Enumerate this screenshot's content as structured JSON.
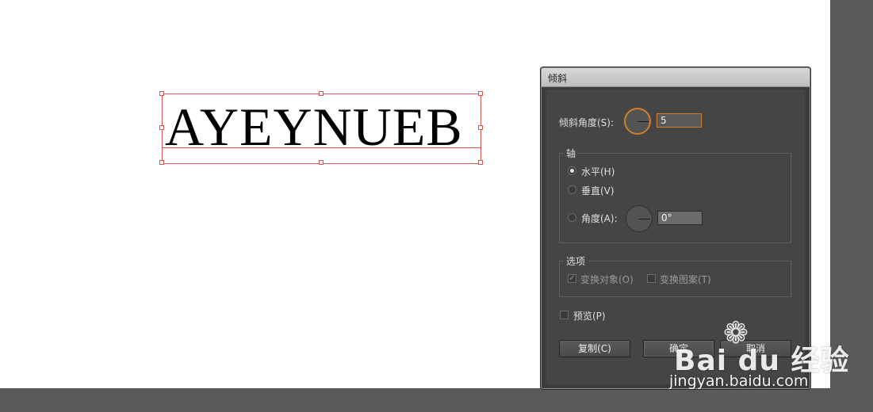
{
  "artboard": {
    "text": "AYEYNUEB"
  },
  "dialog": {
    "title": "倾斜",
    "shear_angle": {
      "label": "倾斜角度(S):",
      "value": "5"
    },
    "axis": {
      "group_title": "轴",
      "options": [
        {
          "label": "水平(H)",
          "selected": true
        },
        {
          "label": "垂直(V)",
          "selected": false
        },
        {
          "label": "角度(A):",
          "selected": false
        }
      ],
      "angle_value": "0°"
    },
    "options": {
      "group_title": "选项",
      "transform_objects": {
        "label": "变换对象(O)",
        "checked": true
      },
      "transform_patterns": {
        "label": "变换图案(T)",
        "checked": false
      }
    },
    "preview": {
      "label": "预览(P)",
      "checked": false
    },
    "buttons": {
      "copy": "复制(C)",
      "ok": "确定",
      "cancel": "取消"
    }
  },
  "watermark": {
    "brand": "Bai du 经验",
    "url": "jingyan.baidu.com"
  },
  "colors": {
    "selection": "#d9534f",
    "focus": "#d07e2c",
    "dialog_bg": "#454545"
  }
}
